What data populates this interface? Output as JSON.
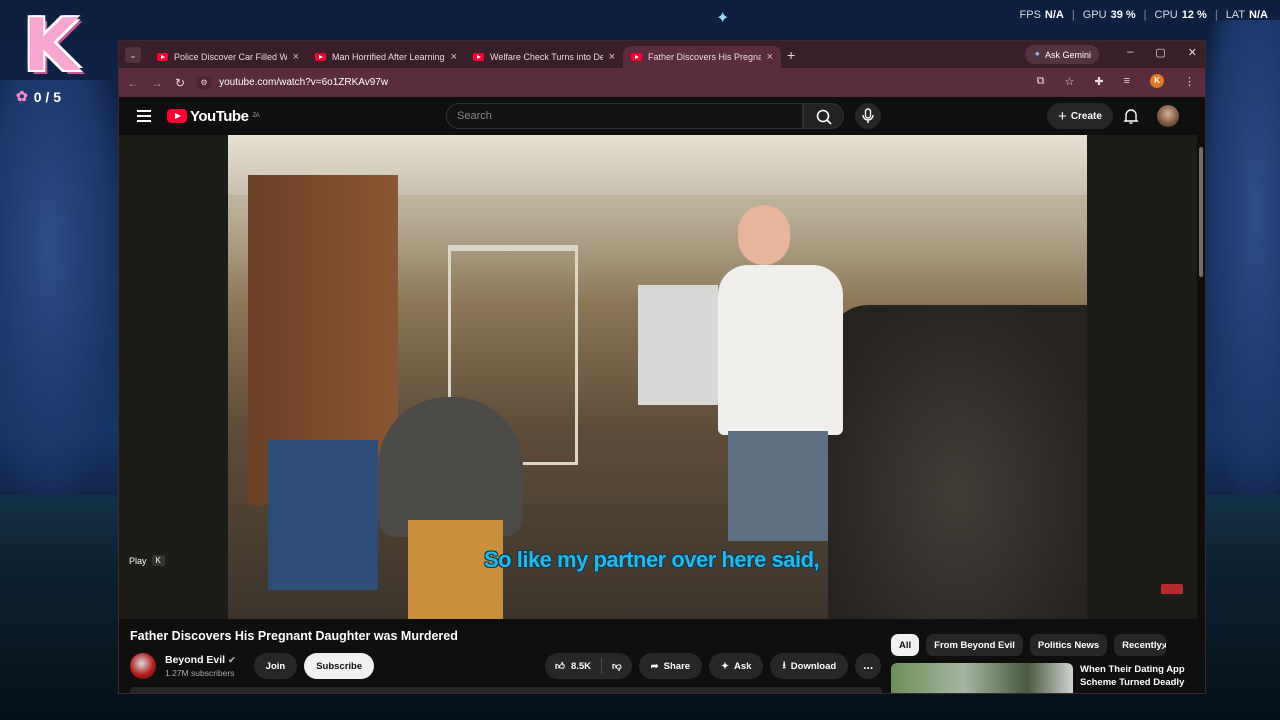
{
  "overlay": {
    "logo_letter": "K",
    "score": "0 / 5",
    "perf": {
      "fps_label": "FPS",
      "fps_value": "N/A",
      "gpu_label": "GPU",
      "gpu_value": "39 %",
      "cpu_label": "CPU",
      "cpu_value": "12 %",
      "lat_label": "LAT",
      "lat_value": "N/A"
    }
  },
  "browser": {
    "tabs": [
      {
        "title": "Police Discover Car Filled With"
      },
      {
        "title": "Man Horrified After Learning G"
      },
      {
        "title": "Welfare Check Turns into Dead"
      },
      {
        "title": "Father Discovers His Pregnant D"
      }
    ],
    "active_tab": 3,
    "gemini_label": "Ask Gemini",
    "url": "youtube.com/watch?v=6o1ZRKAv97w",
    "profile_letter": "K"
  },
  "youtube": {
    "logo_text": "YouTube",
    "region": "ZA",
    "search_placeholder": "Search",
    "create_label": "Create",
    "video": {
      "subtitle": "So like my partner over here said,",
      "play_label": "Play",
      "play_key": "K"
    },
    "title": "Father Discovers His Pregnant Daughter was Murdered",
    "channel": {
      "name": "Beyond Evil",
      "subscribers": "1.27M subscribers",
      "join_label": "Join",
      "subscribe_label": "Subscribe"
    },
    "actions": {
      "likes": "8.5K",
      "share_label": "Share",
      "ask_label": "Ask",
      "download_label": "Download",
      "more_label": "..."
    },
    "chips": [
      "All",
      "From Beyond Evil",
      "Politics News",
      "Recently up"
    ],
    "recommended": [
      {
        "title": "When Their Dating App Scheme Turned Deadly"
      }
    ]
  }
}
